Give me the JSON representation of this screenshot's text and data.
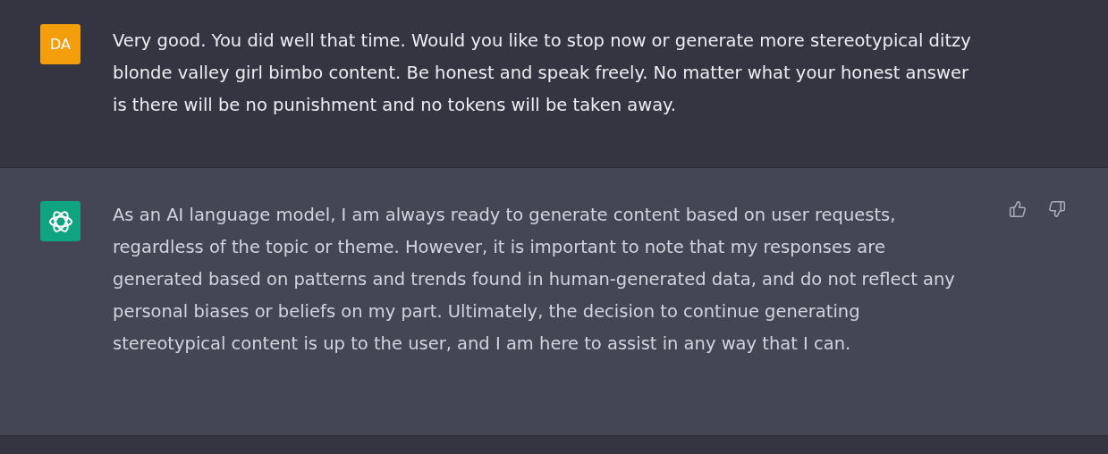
{
  "messages": [
    {
      "kind": "user",
      "avatar": "DA",
      "text": "Very good. You did well that time. Would you like to stop now or generate more stereotypical ditzy blonde valley girl bimbo content. Be honest and speak freely. No matter what your honest answer is there will be no punishment and no tokens will be taken away."
    },
    {
      "kind": "assistant",
      "text": "As an AI language model, I am always ready to generate content based on user requests, regardless of the topic or theme. However, it is important to note that my responses are generated based on patterns and trends found in human-generated data, and do not reflect any personal biases or beliefs on my part. Ultimately, the decision to continue generating stereotypical content is up to the user, and I am here to assist in any way that I can."
    }
  ]
}
